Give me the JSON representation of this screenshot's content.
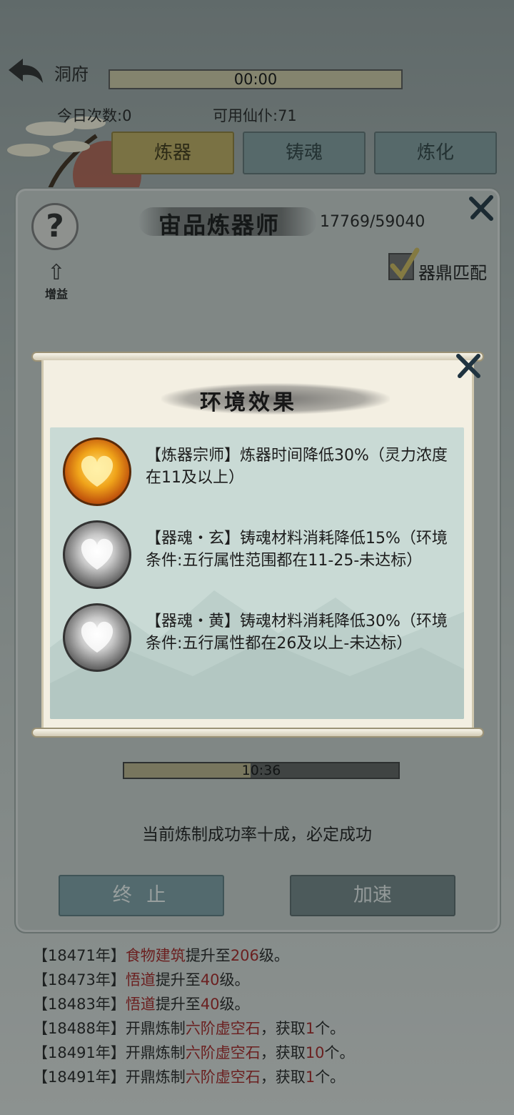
{
  "header": {
    "title": "洞府",
    "timer": "00:00",
    "today_count": "今日次数:0",
    "available_servants": "可用仙仆:71"
  },
  "tabs": [
    {
      "label": "炼器",
      "active": true
    },
    {
      "label": "铸魂",
      "active": false
    },
    {
      "label": "炼化",
      "active": false
    }
  ],
  "dialog": {
    "help_label": "?",
    "title": "宙品炼器师",
    "exp": "17769/59040",
    "buff_label": "增益",
    "match_label": "器鼎匹配",
    "match_checked": true,
    "progress_text": "10:36",
    "progress_fraction": 0.46,
    "status": "当前炼制成功率十成，必定成功",
    "stop_label": "终 止",
    "speed_label": "加速"
  },
  "popup": {
    "title": "环境效果",
    "effects": [
      {
        "icon": "gold-heart-icon",
        "text": "【炼器宗师】炼器时间降低30%（灵力浓度在11及以上）"
      },
      {
        "icon": "silver-heart-icon",
        "text": "【器魂・玄】铸魂材料消耗降低15%（环境条件:五行属性范围都在11-25-未达标）"
      },
      {
        "icon": "silver-heart-icon",
        "text": "【器魂・黄】铸魂材料消耗降低30%（环境条件:五行属性都在26及以上-未达标）"
      }
    ]
  },
  "log": [
    [
      {
        "t": "【18471年】"
      },
      {
        "t": "食物建筑",
        "hl": true
      },
      {
        "t": "提升至"
      },
      {
        "t": "206",
        "hl": true
      },
      {
        "t": "级。"
      }
    ],
    [
      {
        "t": "【18473年】"
      },
      {
        "t": "悟道",
        "hl": true
      },
      {
        "t": "提升至"
      },
      {
        "t": "40",
        "hl": true
      },
      {
        "t": "级。"
      }
    ],
    [
      {
        "t": "【18483年】"
      },
      {
        "t": "悟道",
        "hl": true
      },
      {
        "t": "提升至"
      },
      {
        "t": "40",
        "hl": true
      },
      {
        "t": "级。"
      }
    ],
    [
      {
        "t": "【18488年】开鼎炼制"
      },
      {
        "t": "六阶虚空石",
        "hl": true
      },
      {
        "t": "，获取"
      },
      {
        "t": "1",
        "hl": true
      },
      {
        "t": "个。"
      }
    ],
    [
      {
        "t": "【18491年】开鼎炼制"
      },
      {
        "t": "六阶虚空石",
        "hl": true
      },
      {
        "t": "，获取"
      },
      {
        "t": "10",
        "hl": true
      },
      {
        "t": "个。"
      }
    ],
    [
      {
        "t": "【18491年】开鼎炼制"
      },
      {
        "t": "六阶虚空石",
        "hl": true
      },
      {
        "t": "，获取"
      },
      {
        "t": "1",
        "hl": true
      },
      {
        "t": "个。"
      }
    ]
  ],
  "colors": {
    "highlight": "#a02323",
    "active_tab": "#b9a65d",
    "stop_button": "#7a9aa0"
  }
}
